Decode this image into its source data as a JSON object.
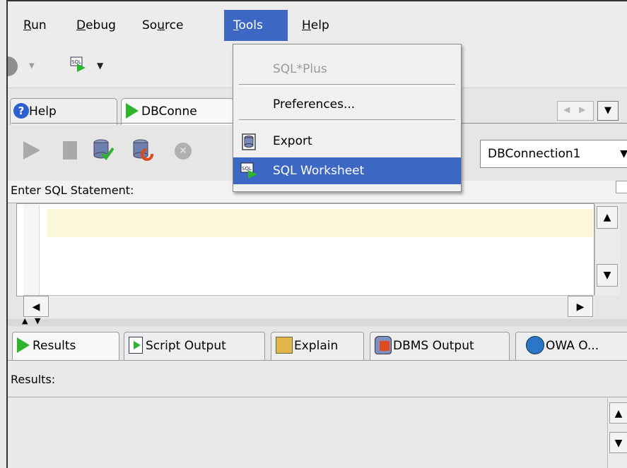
{
  "menubar": {
    "items": [
      "Run",
      "Debug",
      "Source",
      "Tools",
      "Help"
    ],
    "active": "Tools"
  },
  "tools_menu": {
    "items": [
      {
        "label": "SQL*Plus",
        "enabled": false,
        "icon": ""
      },
      {
        "label": "Preferences...",
        "enabled": true,
        "icon": ""
      },
      {
        "label": "Export",
        "enabled": true,
        "icon": "database-icon"
      },
      {
        "label": "SQL Worksheet",
        "enabled": true,
        "icon": "sql-worksheet-icon",
        "selected": true
      }
    ]
  },
  "tabs": {
    "help_label": "Help",
    "dbconnection_label": "DBConne"
  },
  "worksheet": {
    "connection": "DBConnection1",
    "enter_sql_label": "Enter SQL Statement:",
    "results_label": "Results:"
  },
  "result_tabs": {
    "results": "Results",
    "script_output": "Script Output",
    "explain": "Explain",
    "dbms_output": "DBMS Output",
    "owa_output": "OWA O..."
  },
  "colors": {
    "selection": "#3c68c4",
    "editor_current_line": "#fbf8d9",
    "run_green": "#2eb32e"
  }
}
